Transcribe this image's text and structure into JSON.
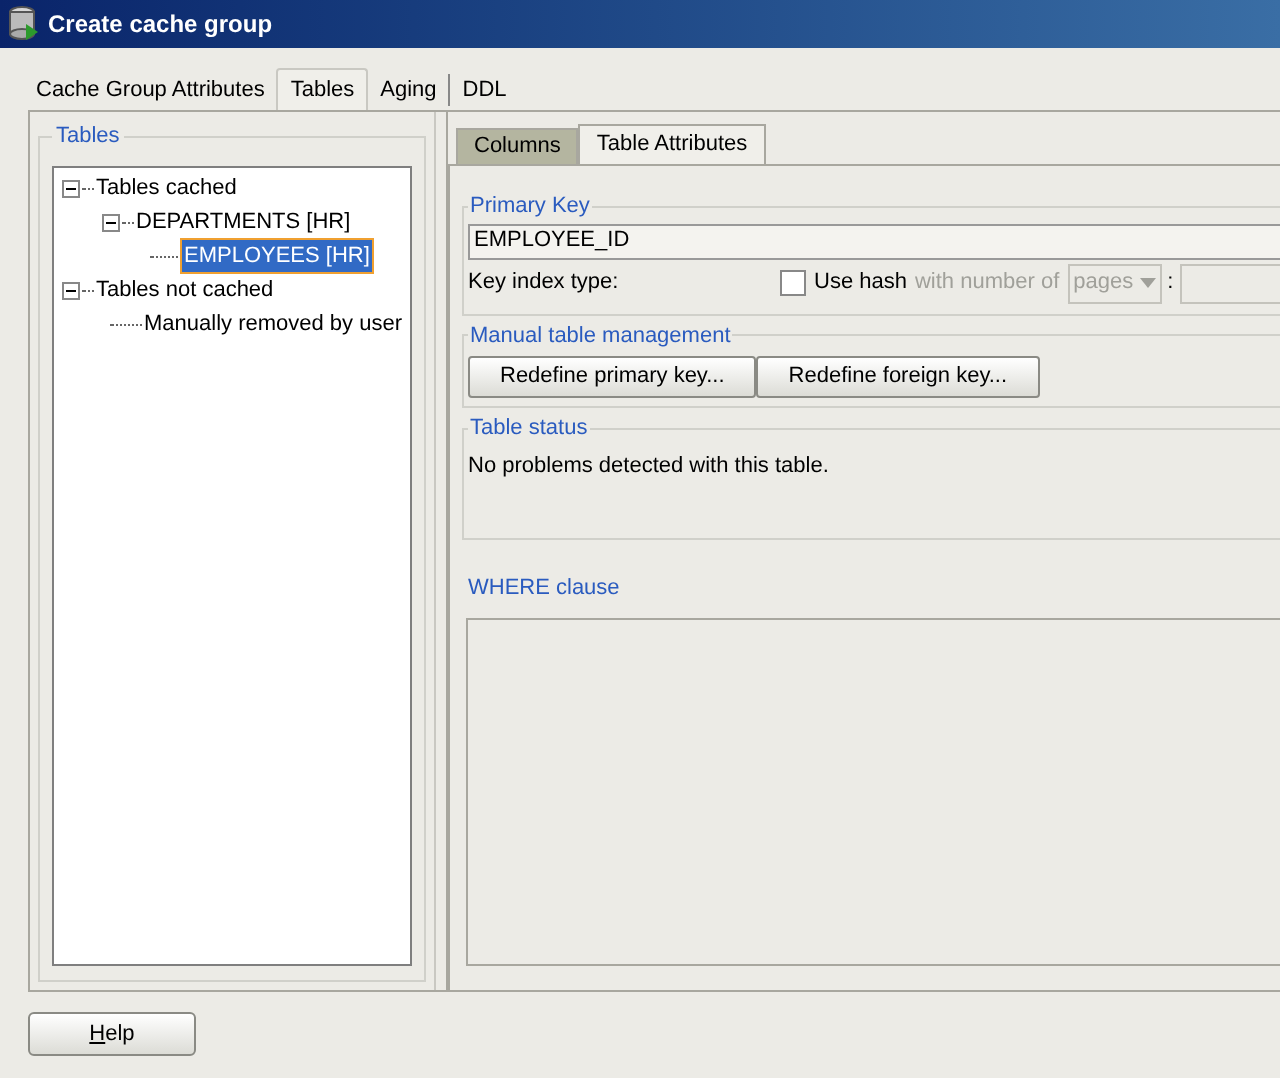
{
  "window": {
    "title": "Create cache group"
  },
  "tabs": [
    {
      "label": "Cache Group Attributes",
      "selected": false
    },
    {
      "label": "Tables",
      "selected": true
    },
    {
      "label": "Aging",
      "selected": false
    },
    {
      "label": "DDL",
      "selected": false
    }
  ],
  "tables_panel": {
    "title": "Tables",
    "tree": [
      {
        "label": "Tables cached",
        "expanded": true,
        "selected": false,
        "children": [
          {
            "label": "DEPARTMENTS [HR]",
            "expanded": true,
            "selected": false,
            "children": [
              {
                "label": "EMPLOYEES [HR]",
                "selected": true
              }
            ]
          }
        ]
      },
      {
        "label": "Tables not cached",
        "expanded": true,
        "selected": false,
        "children": [
          {
            "label": "Manually removed by user",
            "selected": false
          }
        ]
      }
    ]
  },
  "subtabs": [
    {
      "label": "Columns",
      "selected": false
    },
    {
      "label": "Table Attributes",
      "selected": true
    }
  ],
  "primary_key": {
    "title": "Primary Key",
    "value": "EMPLOYEE_ID",
    "key_index_label": "Key index type:",
    "use_hash": {
      "label": "Use hash",
      "checked": false
    },
    "with_number_label": "with number of",
    "unit_dropdown": {
      "value": "pages",
      "disabled": true
    },
    "separator": ":"
  },
  "manual_management": {
    "title": "Manual table management",
    "buttons": [
      "Redefine primary key...",
      "Redefine foreign key..."
    ]
  },
  "table_status": {
    "title": "Table status",
    "message": "No problems detected with this table."
  },
  "where_clause": {
    "title": "WHERE clause"
  },
  "help_button": "Help"
}
